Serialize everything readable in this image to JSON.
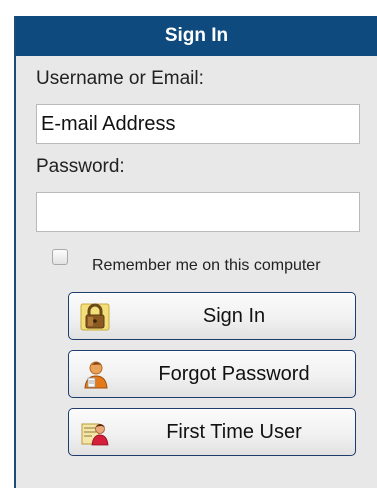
{
  "panel": {
    "title": "Sign In"
  },
  "form": {
    "username_label": "Username or Email:",
    "username_value": "E-mail Address",
    "password_label": "Password:",
    "password_value": "",
    "remember_label": "Remember me on this computer",
    "remember_checked": false
  },
  "buttons": {
    "signin": {
      "label": "Sign In",
      "icon": "lock-icon"
    },
    "forgot": {
      "label": "Forgot Password",
      "icon": "person-icon"
    },
    "first_time": {
      "label": "First Time User",
      "icon": "user-card-icon"
    }
  },
  "colors": {
    "header_bg": "#0f4a7e",
    "panel_bg": "#e8e8e8",
    "button_border": "#1e3c6e"
  }
}
